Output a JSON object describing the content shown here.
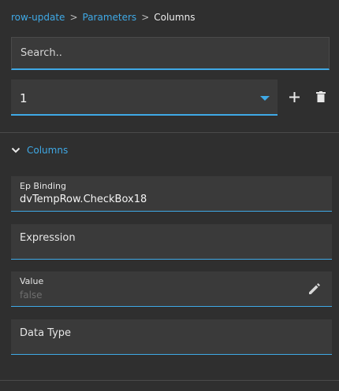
{
  "breadcrumb": {
    "items": [
      "row-update",
      "Parameters"
    ],
    "separator": ">",
    "current": "Columns"
  },
  "search": {
    "placeholder": "Search..",
    "value": ""
  },
  "selector": {
    "selected": "1"
  },
  "actions": {
    "add_icon": "plus-icon",
    "delete_icon": "trash-icon"
  },
  "section": {
    "label": "Columns",
    "expanded": true,
    "icon": "chevron-down-icon"
  },
  "fields": {
    "ep_binding": {
      "label": "Ep Binding",
      "value": "dvTempRow.CheckBox18"
    },
    "expression": {
      "label": "Expression",
      "value": ""
    },
    "value": {
      "label": "Value",
      "value": "false",
      "edit_icon": "pencil-icon"
    },
    "data_type": {
      "label": "Data Type",
      "value": ""
    }
  },
  "colors": {
    "accent": "#3fa9e6",
    "background": "#2f2f2f",
    "field_bg": "#3a3a3a"
  }
}
